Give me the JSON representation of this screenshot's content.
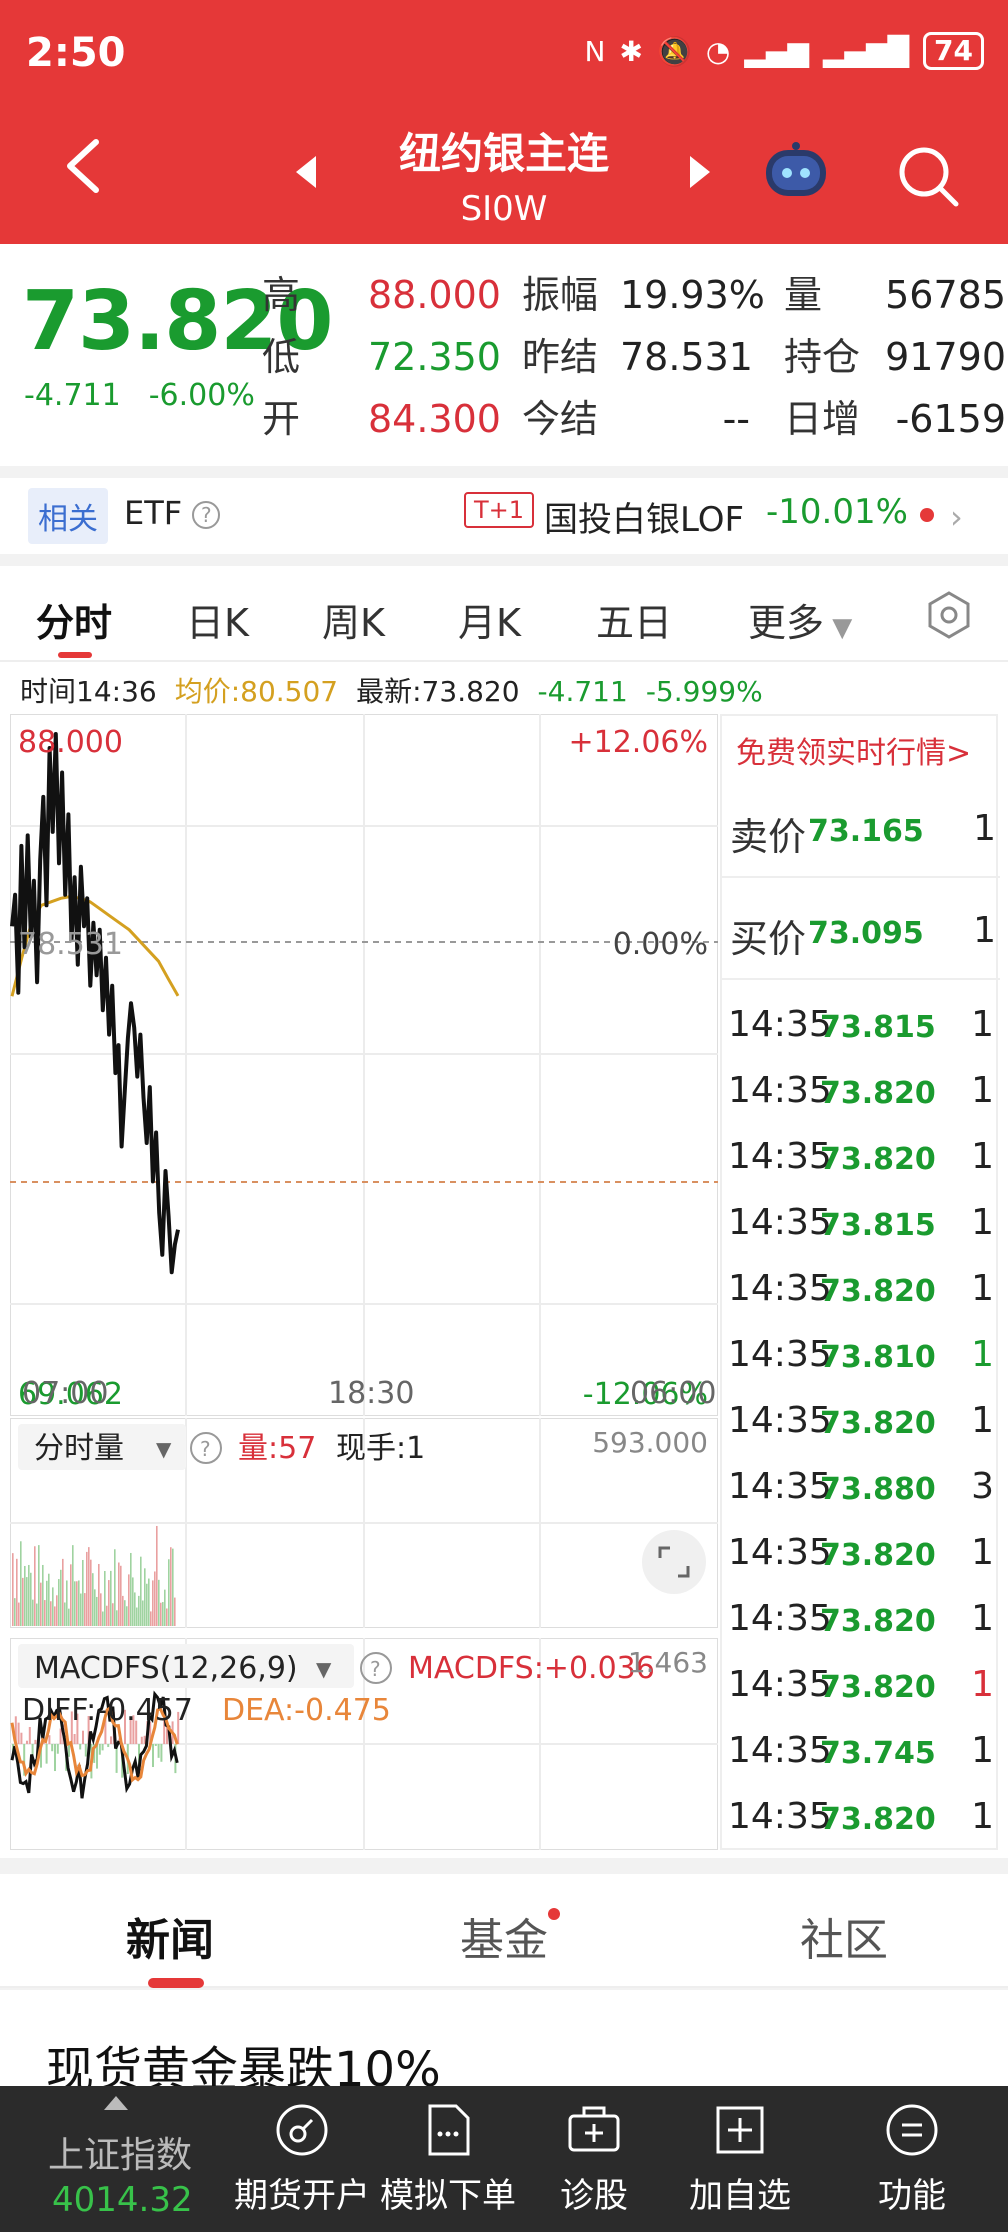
{
  "status_bar": {
    "time": "2:50",
    "battery": "74"
  },
  "header": {
    "title": "纽约银主连",
    "code": "SI0W"
  },
  "quote": {
    "price": "73.820",
    "change": "-4.711",
    "change_pct": "-6.00%",
    "high_label": "高",
    "high": "88.000",
    "low_label": "低",
    "low": "72.350",
    "open_label": "开",
    "open": "84.300",
    "amp_label": "振幅",
    "amp": "19.93%",
    "prevsettle_label": "昨结",
    "prevsettle": "78.531",
    "settle_label": "今结",
    "settle": "--",
    "vol_label": "量",
    "vol": "56785",
    "oi_label": "持仓",
    "oi": "91790",
    "daychg_label": "日增",
    "daychg": "-6159"
  },
  "etf_bar": {
    "related": "相关",
    "etf": "ETF",
    "tplus": "T+1",
    "lof_name": "国投白银LOF",
    "lof_change": "-10.01%"
  },
  "tabs": [
    "分时",
    "日K",
    "周K",
    "月K",
    "五日",
    "更多"
  ],
  "info_bar": {
    "time": "时间14:36",
    "avg": "均价:80.507",
    "latest": "最新:73.820",
    "chg": "-4.711",
    "pct": "-5.999%"
  },
  "chart_labels": {
    "top_price": "88.000",
    "top_pct": "+12.06%",
    "mid_price": "78.531",
    "mid_pct": "0.00%",
    "bottom_price": "69.062",
    "bottom_pct": "-12.06%",
    "x1": "07:00",
    "x2": "18:30",
    "x3": "06:00"
  },
  "volume_panel": {
    "selector": "分时量",
    "vol": "量:57",
    "hand": "现手:1",
    "max": "593.000"
  },
  "macd_panel": {
    "selector": "MACDFS(12,26,9)",
    "macd": "MACDFS:+0.036",
    "diff": "DIFF:-0.457",
    "dea": "DEA:-0.475",
    "max": "1.463"
  },
  "chart_data": {
    "type": "line",
    "y_range": [
      69.062,
      88.0
    ],
    "reference": 78.531,
    "series": [
      {
        "values": [
          82.5,
          83.4,
          80.6,
          84.8,
          81.9,
          85.1,
          82.2,
          83.8,
          80.9,
          84.4,
          86.2,
          83.1,
          87.6,
          85.2,
          88.0,
          84.3,
          86.9,
          83.4,
          85.7,
          82.1,
          83.9,
          81.4,
          84.2,
          82.5,
          83.3,
          80.8,
          82.6,
          81.1,
          82.4,
          80.1,
          81.6,
          79.4,
          80.8,
          78.3,
          79.1,
          76.2,
          77.8,
          79.3,
          80.3,
          79.6,
          78.2,
          79.4,
          77.6,
          76.3,
          77.9,
          75.2,
          76.6,
          74.3,
          73.1,
          75.5,
          74.2,
          72.6,
          73.4,
          73.82
        ]
      },
      {
        "name": "均价",
        "values": [
          80.5,
          81.6,
          82.6,
          83.1,
          83.2,
          83.3,
          83.35,
          83.3,
          83.2,
          83.0,
          82.8,
          82.6,
          82.4,
          82.1,
          81.8,
          81.5,
          81.0,
          80.507
        ]
      }
    ]
  },
  "ticks": {
    "header": "免费领实时行情>",
    "ask_label": "卖价",
    "ask": "73.165",
    "ask_vol": "1",
    "bid_label": "买价",
    "bid": "73.095",
    "bid_vol": "1",
    "rows": [
      {
        "t": "14:35",
        "p": "73.815",
        "v": "1",
        "vc": "black"
      },
      {
        "t": "14:35",
        "p": "73.820",
        "v": "1",
        "vc": "black"
      },
      {
        "t": "14:35",
        "p": "73.820",
        "v": "1",
        "vc": "black"
      },
      {
        "t": "14:35",
        "p": "73.815",
        "v": "1",
        "vc": "black"
      },
      {
        "t": "14:35",
        "p": "73.820",
        "v": "1",
        "vc": "black"
      },
      {
        "t": "14:35",
        "p": "73.810",
        "v": "1",
        "vc": "green"
      },
      {
        "t": "14:35",
        "p": "73.820",
        "v": "1",
        "vc": "black"
      },
      {
        "t": "14:35",
        "p": "73.880",
        "v": "3",
        "vc": "black"
      },
      {
        "t": "14:35",
        "p": "73.820",
        "v": "1",
        "vc": "black"
      },
      {
        "t": "14:35",
        "p": "73.820",
        "v": "1",
        "vc": "black"
      },
      {
        "t": "14:35",
        "p": "73.820",
        "v": "1",
        "vc": "red"
      },
      {
        "t": "14:35",
        "p": "73.745",
        "v": "1",
        "vc": "black"
      },
      {
        "t": "14:35",
        "p": "73.820",
        "v": "1",
        "vc": "black"
      }
    ]
  },
  "news_tabs": [
    "新闻",
    "基金",
    "社区"
  ],
  "headline": "现货黄金暴跌10%",
  "bottom_bar": {
    "index_name": "上证指数",
    "index_value": "4014.32",
    "buttons": [
      "期货开户",
      "模拟下单",
      "诊股",
      "加自选",
      "功能"
    ]
  },
  "colors": {
    "accent": "#e53838",
    "up": "#d8303a",
    "down": "#1a9b2f",
    "avg_line": "#d4a020"
  }
}
